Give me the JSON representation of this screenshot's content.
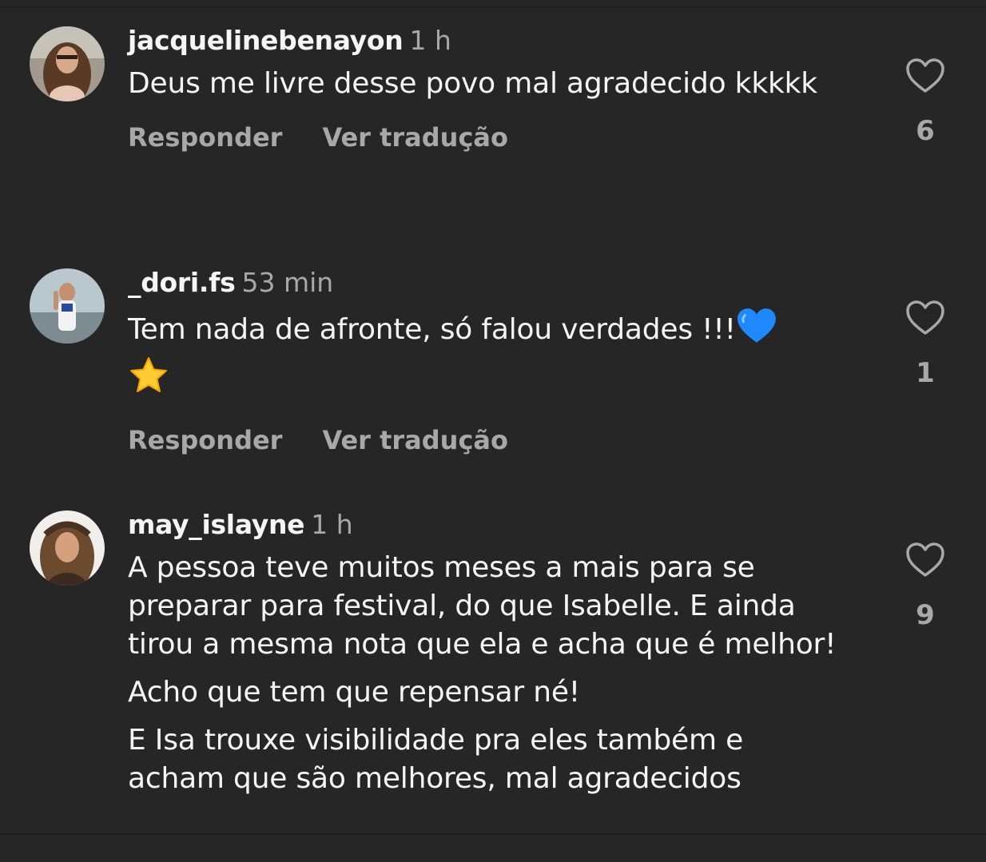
{
  "comments": [
    {
      "username": "jacquelinebenayon",
      "time": "1 h",
      "paragraphs": [
        "Deus me livre desse povo mal agradecido kkkkk"
      ],
      "reply_label": "Responder",
      "translate_label": "Ver tradução",
      "like_count": "6"
    },
    {
      "username": "_dori.fs",
      "time": "53 min",
      "paragraphs": [
        "Tem nada de afronte, só falou verdades !!!"
      ],
      "reply_label": "Responder",
      "translate_label": "Ver tradução",
      "like_count": "1"
    },
    {
      "username": "may_islayne",
      "time": "1 h",
      "paragraphs": [
        "A pessoa teve muitos meses a mais para se preparar para festival, do que Isabelle. E ainda tirou a mesma nota que ela e acha que é melhor!",
        "Acho que tem que repensar né!",
        "E Isa trouxe visibilidade pra eles também e acham que são melhores, mal agradecidos"
      ],
      "like_count": "9"
    }
  ],
  "icons": {
    "like": "heart-outline-icon",
    "emoji_heart": "blue-heart-emoji-icon",
    "emoji_star": "star-emoji-icon"
  },
  "colors": {
    "background": "#262626",
    "primary_text": "#f5f5f5",
    "secondary_text": "#a8a8a8",
    "blue_heart": "#1e88ff",
    "star": "#ffcc33"
  }
}
